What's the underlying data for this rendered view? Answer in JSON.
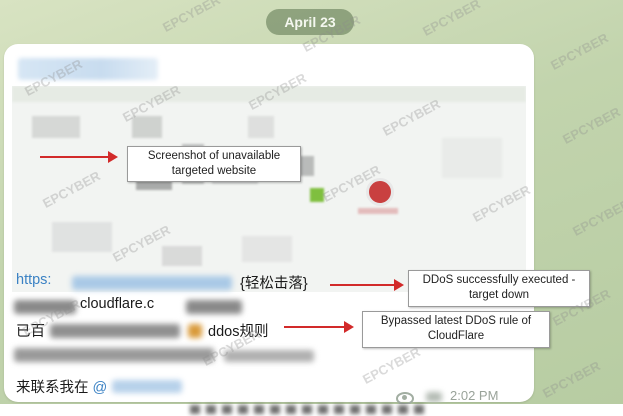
{
  "chat": {
    "date_label": "April 23"
  },
  "annotations": {
    "screenshot_note": "Screenshot of unavailable targeted website",
    "ddos_success": "DDoS successfully executed - target down",
    "bypass_note": "Bypassed latest DDoS rule of CloudFlare"
  },
  "message": {
    "line1_link": "https:",
    "line1_suffix": "{轻松击落}",
    "line2_domain": "cloudflare.c",
    "line3_prefix": "已百",
    "line3_suffix": "ddos规则",
    "line5_prefix": "来联系我在",
    "line5_mention": "@",
    "time": "2:02 PM"
  },
  "watermark": {
    "text": "EPCYBER"
  },
  "colors": {
    "chat_background": "#c9d8b4",
    "bubble": "#ffffff",
    "link": "#3b82c4",
    "arrow": "#d22a2a",
    "date_pill": "#768c66"
  },
  "icons": {
    "views": "eye-icon",
    "arrow": "red-arrow",
    "site_logo": "error-icon"
  }
}
